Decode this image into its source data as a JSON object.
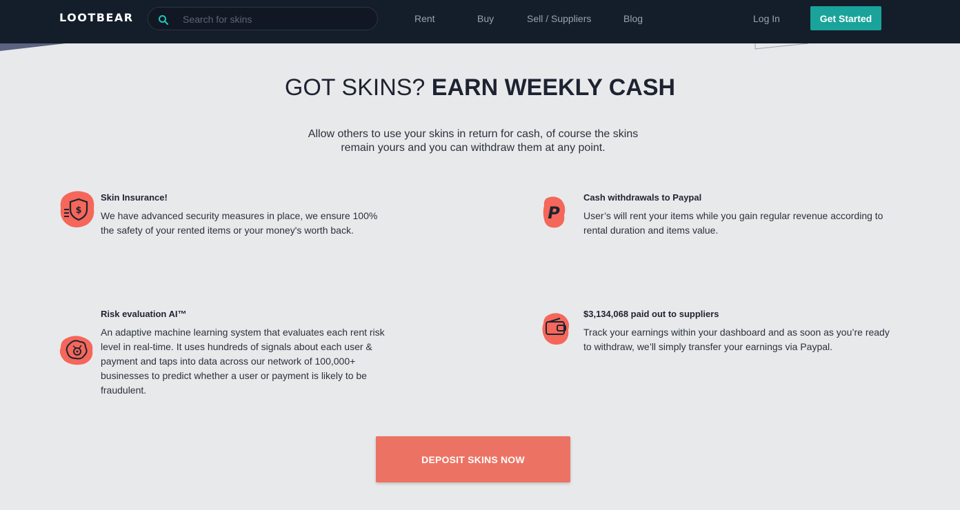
{
  "header": {
    "logo": "LOOTBEAR",
    "search_placeholder": "Search for skins",
    "nav": [
      "Rent",
      "Buy",
      "Sell / Suppliers",
      "Blog"
    ],
    "login": "Log In",
    "cta": "Get Started"
  },
  "hero": {
    "title_light": "GOT SKINS? ",
    "title_bold": "EARN WEEKLY CASH",
    "subtitle": "Allow others to use your skins in return for cash, of course the skins remain yours and you can withdraw them at any point."
  },
  "features": [
    {
      "icon": "shield-dollar-icon",
      "title": "Skin Insurance!",
      "text": "We have advanced security measures in place, we ensure 100% the safety of your rented items or your money's worth back."
    },
    {
      "icon": "paypal-icon",
      "title": "Cash withdrawals to Paypal",
      "text": "User’s will rent your items while you gain regular revenue according to rental duration and items value."
    },
    {
      "icon": "brain-gear-icon",
      "title": "Risk evaluation AI™",
      "text": "An adaptive machine learning system that evaluates each rent risk level in real-time. It uses hundreds of signals about each user & payment and taps into data across our network of 100,000+ businesses to predict whether a user or payment is likely to be fraudulent."
    },
    {
      "icon": "wallet-icon",
      "title": "$3,134,068 paid out to suppliers",
      "text": "Track your earnings within your dashboard and as soon as you’re ready to withdraw, we’ll simply transfer your earnings via Paypal."
    }
  ],
  "deposit_button": "DEPOSIT SKINS NOW",
  "colors": {
    "header_bg": "#141d2a",
    "accent_teal": "#1aa39a",
    "accent_coral": "#ec7263",
    "page_bg": "#e8e9eb"
  }
}
